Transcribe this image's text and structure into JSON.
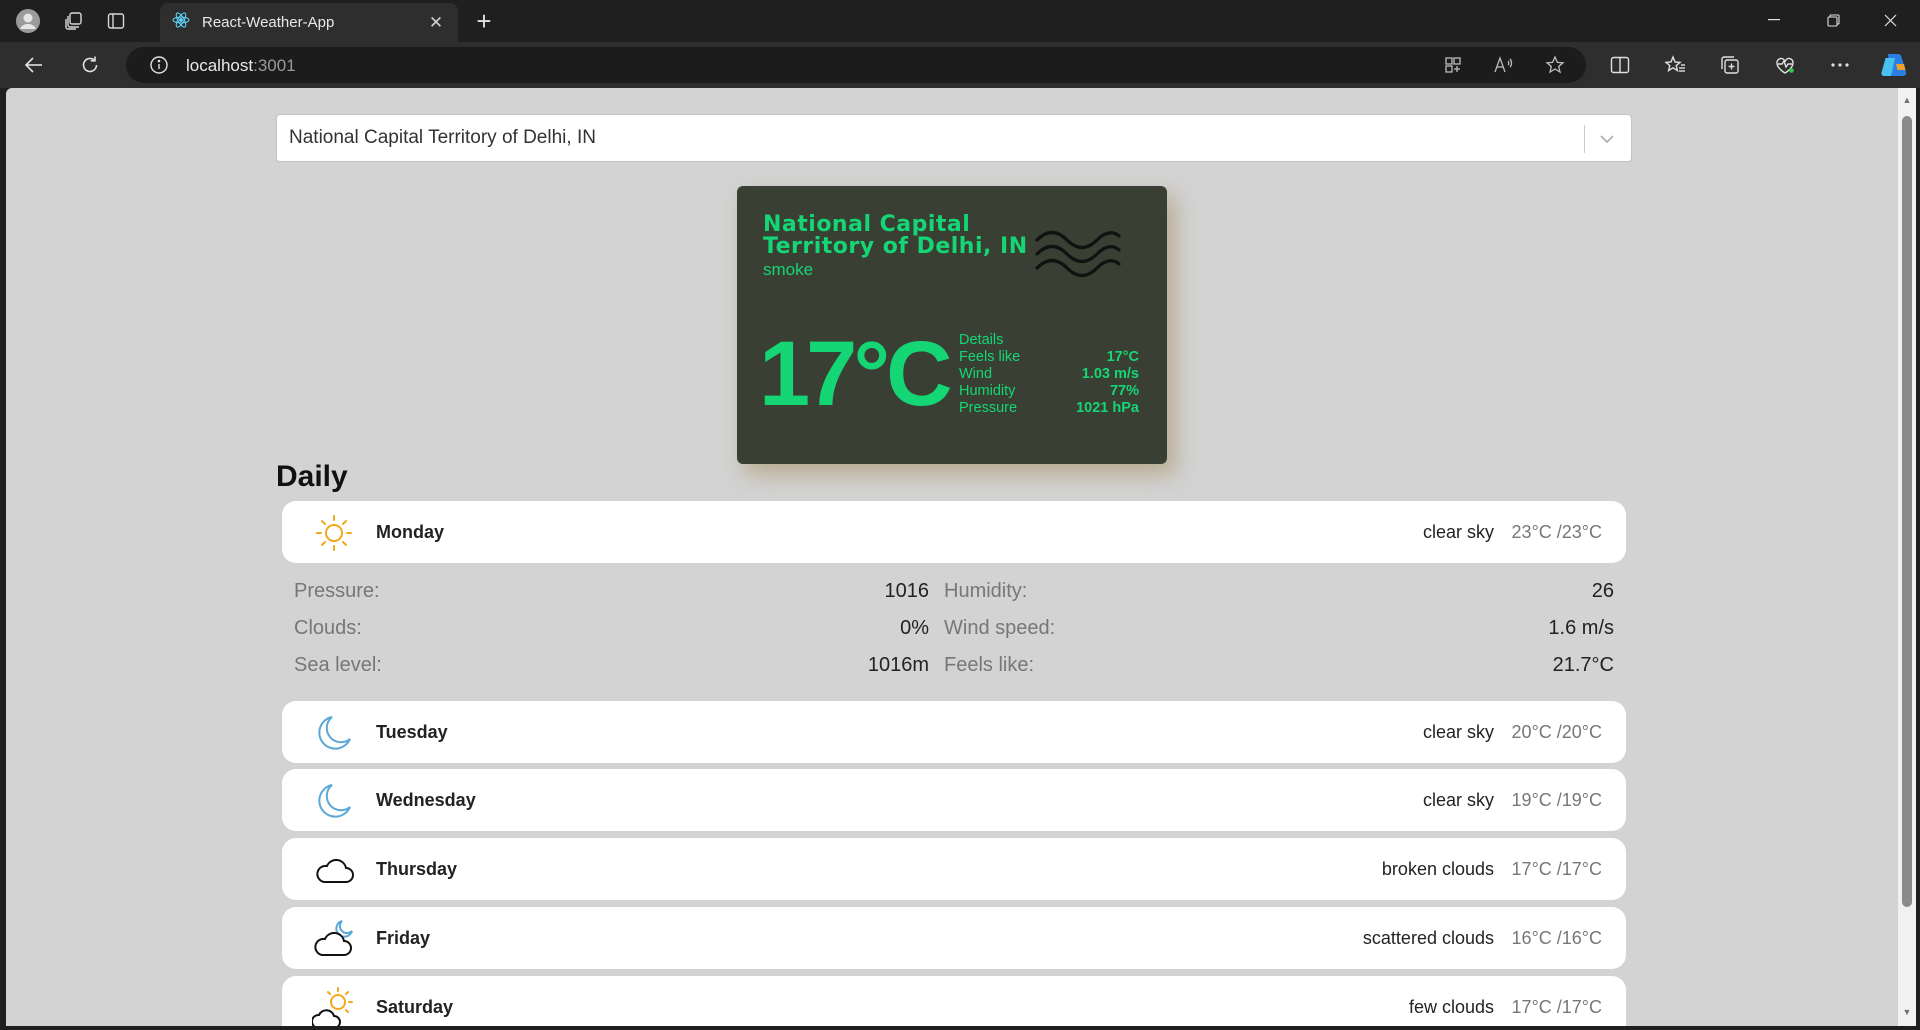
{
  "browser": {
    "tab_title": "React-Weather-App",
    "url_host": "localhost",
    "url_port": ":3001"
  },
  "city_select": {
    "value": "National Capital Territory of Delhi, IN"
  },
  "current": {
    "city": "National Capital Territory of Delhi, IN",
    "description": "smoke",
    "icon": "smoke-waves-icon",
    "temperature": "17°C",
    "details_label": "Details",
    "details": [
      {
        "label": "Feels like",
        "value": "17°C"
      },
      {
        "label": "Wind",
        "value": "1.03 m/s"
      },
      {
        "label": "Humidity",
        "value": "77%"
      },
      {
        "label": "Pressure",
        "value": "1021 hPa"
      }
    ]
  },
  "daily": {
    "title": "Daily",
    "days": [
      {
        "name": "Monday",
        "description": "clear sky",
        "temps": "23°C /23°C",
        "icon": "sun-icon"
      },
      {
        "name": "Tuesday",
        "description": "clear sky",
        "temps": "20°C /20°C",
        "icon": "moon-icon"
      },
      {
        "name": "Wednesday",
        "description": "clear sky",
        "temps": "19°C /19°C",
        "icon": "moon-icon"
      },
      {
        "name": "Thursday",
        "description": "broken clouds",
        "temps": "17°C /17°C",
        "icon": "cloud-icon"
      },
      {
        "name": "Friday",
        "description": "scattered clouds",
        "temps": "16°C /16°C",
        "icon": "cloud-moon-icon"
      },
      {
        "name": "Saturday",
        "description": "few clouds",
        "temps": "17°C /17°C",
        "icon": "sun-cloud-icon"
      }
    ],
    "expanded_details": {
      "pressure_label": "Pressure:",
      "pressure_value": "1016",
      "humidity_label": "Humidity:",
      "humidity_value": "26",
      "clouds_label": "Clouds:",
      "clouds_value": "0%",
      "wind_label": "Wind speed:",
      "wind_value": "1.6 m/s",
      "sea_label": "Sea level:",
      "sea_value": "1016m",
      "feels_label": "Feels like:",
      "feels_value": "21.7°C"
    }
  },
  "colors": {
    "accent_green": "#15d675",
    "card_bg": "#3a3f34",
    "page_bg": "#d3d3d3"
  }
}
